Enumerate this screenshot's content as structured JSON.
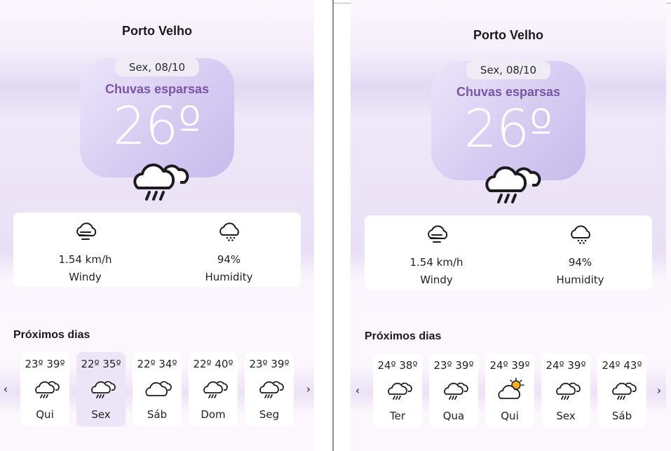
{
  "left": {
    "city": "Porto Velho",
    "date": "Sex, 08/10",
    "condition": "Chuvas esparsas",
    "temperature": "26º",
    "main_icon": "rain-cloud-icon",
    "wind": {
      "value": "1.54 km/h",
      "label": "Windy",
      "icon": "wind-cloud-icon"
    },
    "humidity": {
      "value": "94%",
      "label": "Humidity",
      "icon": "humidity-cloud-icon"
    },
    "next_title": "Próximos dias",
    "prev_arrow": "‹",
    "next_arrow": "›",
    "days": [
      {
        "range": "23º 39º",
        "name": "Qui",
        "icon": "rain-cloud-icon",
        "selected": false
      },
      {
        "range": "22º 35º",
        "name": "Sex",
        "icon": "rain-cloud-icon",
        "selected": true
      },
      {
        "range": "22º 34º",
        "name": "Sáb",
        "icon": "cloud-icon",
        "selected": false
      },
      {
        "range": "22º 40º",
        "name": "Dom",
        "icon": "rain-cloud-icon",
        "selected": false
      },
      {
        "range": "23º 39º",
        "name": "Seg",
        "icon": "rain-cloud-icon",
        "selected": false
      }
    ]
  },
  "right": {
    "city": "Porto Velho",
    "date": "Sex, 08/10",
    "condition": "Chuvas esparsas",
    "temperature": "26º",
    "main_icon": "rain-cloud-icon",
    "wind": {
      "value": "1.54 km/h",
      "label": "Windy",
      "icon": "wind-cloud-icon"
    },
    "humidity": {
      "value": "94%",
      "label": "Humidity",
      "icon": "humidity-cloud-icon"
    },
    "next_title": "Próximos dias",
    "prev_arrow": "‹",
    "next_arrow": "›",
    "days": [
      {
        "range": "24º 38º",
        "name": "Ter",
        "icon": "rain-cloud-icon",
        "selected": false
      },
      {
        "range": "23º 39º",
        "name": "Qua",
        "icon": "rain-cloud-icon",
        "selected": false
      },
      {
        "range": "24º 39º",
        "name": "Qui",
        "icon": "sun-cloud-icon",
        "selected": false
      },
      {
        "range": "24º 39º",
        "name": "Sex",
        "icon": "rain-cloud-icon",
        "selected": false
      },
      {
        "range": "24º 43º",
        "name": "Sáb",
        "icon": "rain-cloud-icon",
        "selected": false
      }
    ]
  },
  "colors": {
    "accent": "#7a55a8",
    "card": "#d6ccf2",
    "selected_day": "#ece4f7",
    "sun": "#f5b21b"
  }
}
